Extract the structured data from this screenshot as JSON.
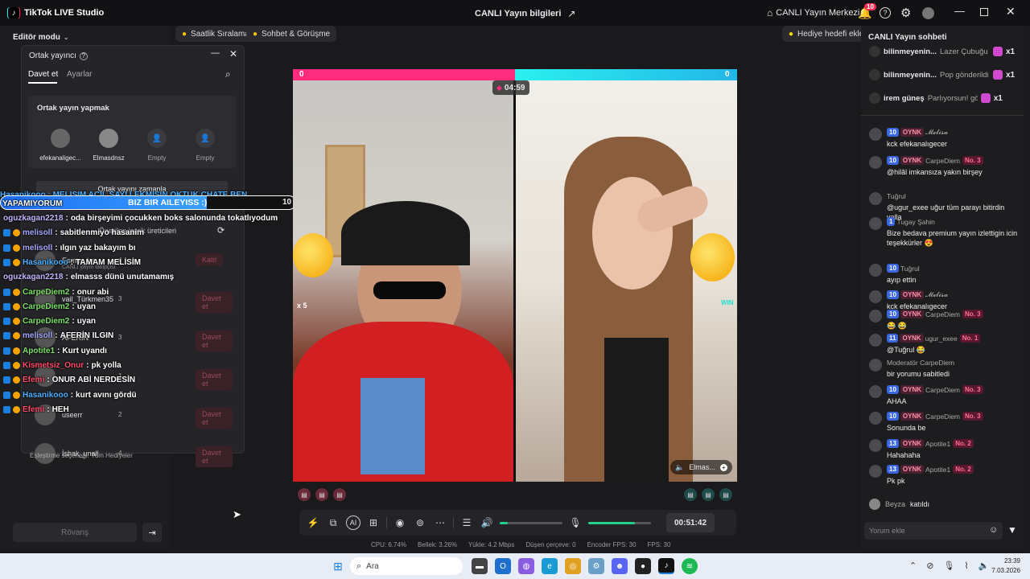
{
  "app": {
    "title": "TikTok LIVE Studio",
    "center_title": "CANLI Yayın bilgileri",
    "live_center": "CANLI Yayın Merkezi",
    "notif_count": "10"
  },
  "topbar": {
    "mode": "Editör modu",
    "hourly": "Saatlik Sıralama",
    "chat_meet": "Sohbet & Görüşme",
    "gift_goal": "Hediye hedefi ekle"
  },
  "cohost": {
    "title": "Ortak yayıncı",
    "tab_invite": "Davet et",
    "tab_settings": "Ayarlar",
    "section": "Ortak yayın yapmak",
    "slots": [
      "efekanaligec...",
      "Elmasdnsz",
      "Empty",
      "Empty"
    ],
    "schedule": "Ortak yayını zamanla",
    "suggested": "Önerilen içerik üreticileri",
    "list": [
      {
        "name": "Esmer_ler",
        "count": "4",
        "btn": "Katıl"
      },
      {
        "name": "vail_Türkmen35",
        "count": "3",
        "btn": "Davet et"
      },
      {
        "name": "AFERIN",
        "count": "3",
        "btn": "Davet et"
      },
      {
        "name": "",
        "count": "1",
        "btn": "Davet et"
      },
      {
        "name": "useerr",
        "count": "2",
        "btn": "Davet et"
      },
      {
        "name": "İshak_unall",
        "count": "4",
        "btn": "Davet et"
      }
    ],
    "live_following": "CANLI yayın takipçisi",
    "match_option": "Eşleştirme seçeneği: Tüm Hediyeler"
  },
  "rematch": "Rövanş",
  "overlay": {
    "team_text": "BIZ BIR AILEYISS :)",
    "team_num": "10",
    "first_line": "YAPAMIYORUM",
    "top_line": "Hasanikooo : MELISIM ACIL SAYI LEKMISIN OKTUK CHATE BEN",
    "lines": [
      {
        "user": "oguzkagan2218",
        "msg": "oda birşeyimi çocukken boks salonunda tokatlıyodum",
        "color": "#c7b3ff"
      },
      {
        "user": "melisoll",
        "msg": "sabitlenmiyo hasanim",
        "color": "#a9a9ff"
      },
      {
        "user": "melisoll",
        "msg": "ılgın yaz bakayım bı",
        "color": "#a9a9ff"
      },
      {
        "user": "Hasanikooo",
        "msg": "TAMAM MELİSİM",
        "color": "#4ab0ff"
      },
      {
        "user": "oguzkagan2218",
        "msg": "elmasss dünü unutamamış",
        "color": "#c7b3ff"
      },
      {
        "user": "CarpeDiem2",
        "msg": "onur abi",
        "color": "#7de06a"
      },
      {
        "user": "CarpeDiem2",
        "msg": "uyan",
        "color": "#7de06a"
      },
      {
        "user": "CarpeDiem2",
        "msg": "uyan",
        "color": "#7de06a"
      },
      {
        "user": "melisoll",
        "msg": "AFERİN ILGIN",
        "color": "#a9a9ff"
      },
      {
        "user": "Apotite1",
        "msg": "Kurt uyandı",
        "color": "#7de06a"
      },
      {
        "user": "Kismetsiz_Onur",
        "msg": "pk yolla",
        "color": "#ff4a6a"
      },
      {
        "user": "Efemi",
        "msg": "ONUR ABİ NERDESİN",
        "color": "#ff4a6a"
      },
      {
        "user": "Hasanikooo",
        "msg": "kurt avını gördü",
        "color": "#4ab0ff"
      },
      {
        "user": "Efemi",
        "msg": "HEH",
        "color": "#ff4a6a"
      }
    ]
  },
  "battle": {
    "left_score": "0",
    "right_score": "0",
    "timer": "04:59",
    "multiplier": "x 5",
    "right_name": "Elmas...",
    "wm": "WIN"
  },
  "controls": {
    "duration": "00:51:42"
  },
  "stats": {
    "cpu": "CPU: 6.74%",
    "mem": "Bellek: 3.26%",
    "upload": "Yükle: 4.2 Mbps",
    "dropped": "Düşen çerçeve: 0",
    "enc_fps": "Encoder FPS: 30",
    "fps": "FPS: 30"
  },
  "chat": {
    "title": "CANLI Yayın sohbeti",
    "gifts": [
      {
        "user": "bilinmeyenin...",
        "msg": "Lazer Çubuğu g",
        "count": "x1"
      },
      {
        "user": "bilinmeyenin...",
        "msg": "Pop gönderildi",
        "count": "x1"
      },
      {
        "user": "irem güneş",
        "msg": "Parlıyorsun! gönde",
        "count": "x1"
      }
    ],
    "messages": [
      {
        "lvl": "10",
        "oynk": "OYNK",
        "name": "𝓜𝓮𝓵𝓲𝓼𝓪",
        "no": "",
        "text": "kck efekanalıgecer"
      },
      {
        "lvl": "10",
        "oynk": "OYNK",
        "name": "CarpeDiem",
        "no": "No. 3",
        "text": "@hilâl imkansıza yakın birşey"
      },
      {
        "lvl": "",
        "oynk": "",
        "name": "Tuğrul",
        "no": "",
        "text": "@ugur_exee uğur tüm parayı bitirdin valla"
      },
      {
        "lvl": "1",
        "oynk": "",
        "name": "Tugay Şahin",
        "no": "",
        "text": "Bize bedava premium yayın izlettigin icin teşekkürler 😍"
      },
      {
        "lvl": "10",
        "oynk": "",
        "name": "Tuğrul",
        "no": "",
        "text": "ayıp ettin"
      },
      {
        "lvl": "10",
        "oynk": "OYNK",
        "name": "𝓜𝓮𝓵𝓲𝓼𝓪",
        "no": "",
        "text": "kck efekanalıgecer"
      },
      {
        "lvl": "10",
        "oynk": "OYNK",
        "name": "CarpeDiem",
        "no": "No. 3",
        "text": "😂 😂"
      },
      {
        "lvl": "11",
        "oynk": "OYNK",
        "name": "ugur_exee",
        "no": "No. 1",
        "text": "@Tuğrul 😂"
      },
      {
        "lvl": "",
        "oynk": "",
        "name": "Moderatör CarpeDiem",
        "no": "",
        "text": "bir yorumu sabitledi"
      },
      {
        "lvl": "10",
        "oynk": "OYNK",
        "name": "CarpeDiem",
        "no": "No. 3",
        "text": "AHAA"
      },
      {
        "lvl": "10",
        "oynk": "OYNK",
        "name": "CarpeDiem",
        "no": "No. 3",
        "text": "Sonunda be"
      },
      {
        "lvl": "13",
        "oynk": "OYNK",
        "name": "Apotite1",
        "no": "No. 2",
        "text": "Hahahaha"
      },
      {
        "lvl": "13",
        "oynk": "OYNK",
        "name": "Apotite1",
        "no": "No. 2",
        "text": "Pk pk"
      }
    ],
    "joined_user": "Beyza",
    "joined_text": "katıldı",
    "input_placeholder": "Yorum ekle"
  },
  "taskbar": {
    "search": "Ara",
    "time": "23:39",
    "date": "7.03.2026"
  },
  "colors": {
    "pink": "#fe2c7d",
    "cyan": "#25d3e6",
    "bg": "#1a1a1c"
  }
}
